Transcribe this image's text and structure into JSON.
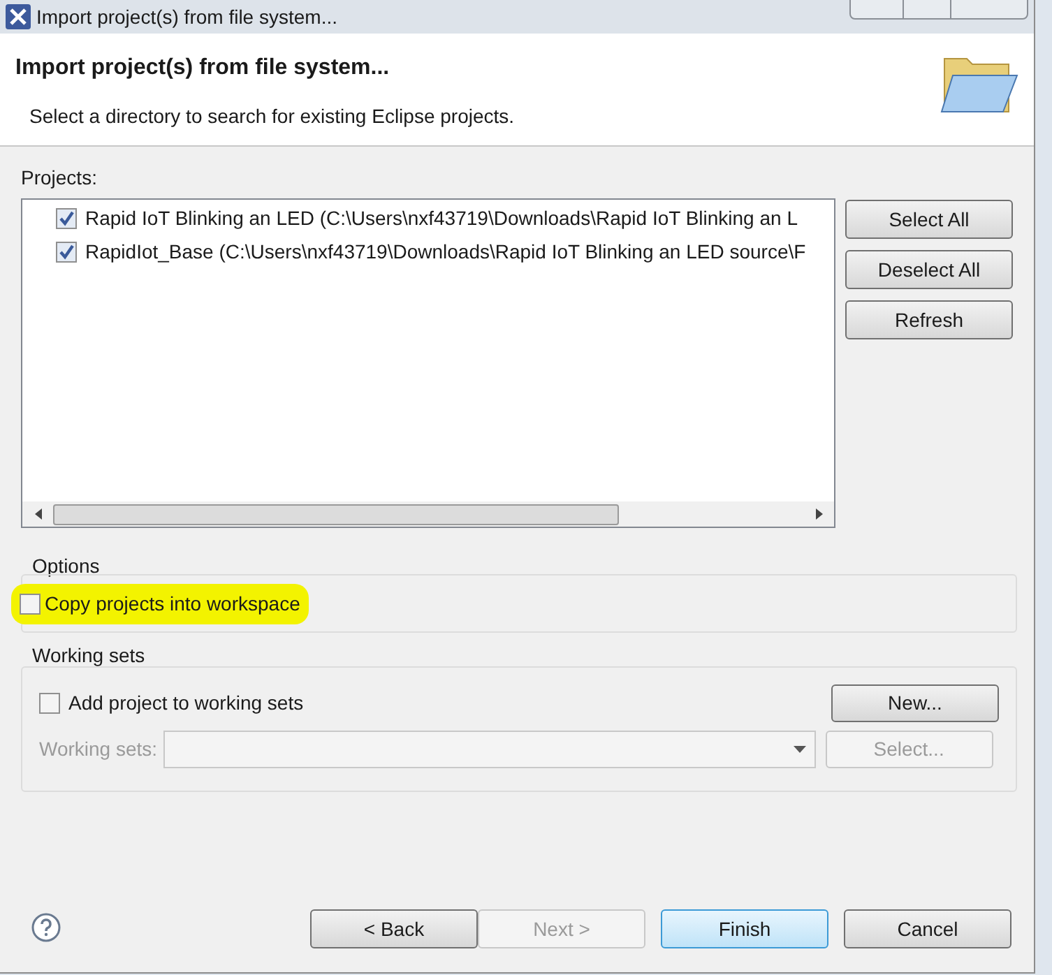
{
  "window": {
    "title": "Import project(s) from file system..."
  },
  "header": {
    "title": "Import project(s) from file system...",
    "description": "Select a directory to search for existing Eclipse projects."
  },
  "projects": {
    "label": "Projects:",
    "items": [
      {
        "text": "Rapid IoT Blinking an LED (C:\\Users\\nxf43719\\Downloads\\Rapid IoT Blinking an L",
        "checked": true
      },
      {
        "text": "RapidIot_Base (C:\\Users\\nxf43719\\Downloads\\Rapid IoT Blinking an LED source\\F",
        "checked": true
      }
    ],
    "buttons": [
      "Select All",
      "Deselect All",
      "Refresh"
    ]
  },
  "options": {
    "label": "Options",
    "items": [
      {
        "label": "Copy projects into workspace",
        "checked": false,
        "highlighted": true
      }
    ]
  },
  "working_sets": {
    "label": "Working sets",
    "checkbox": {
      "label": "Add project to working sets",
      "checked": false
    },
    "new_button": "New...",
    "field_label": "Working sets:",
    "select_button": "Select...",
    "disabled": true
  },
  "footer": {
    "buttons": [
      {
        "label": "< Back",
        "disabled": false,
        "default": false
      },
      {
        "label": "Next >",
        "disabled": true,
        "default": false
      },
      {
        "label": "Finish",
        "disabled": false,
        "default": true
      },
      {
        "label": "Cancel",
        "disabled": false,
        "default": false
      }
    ]
  }
}
